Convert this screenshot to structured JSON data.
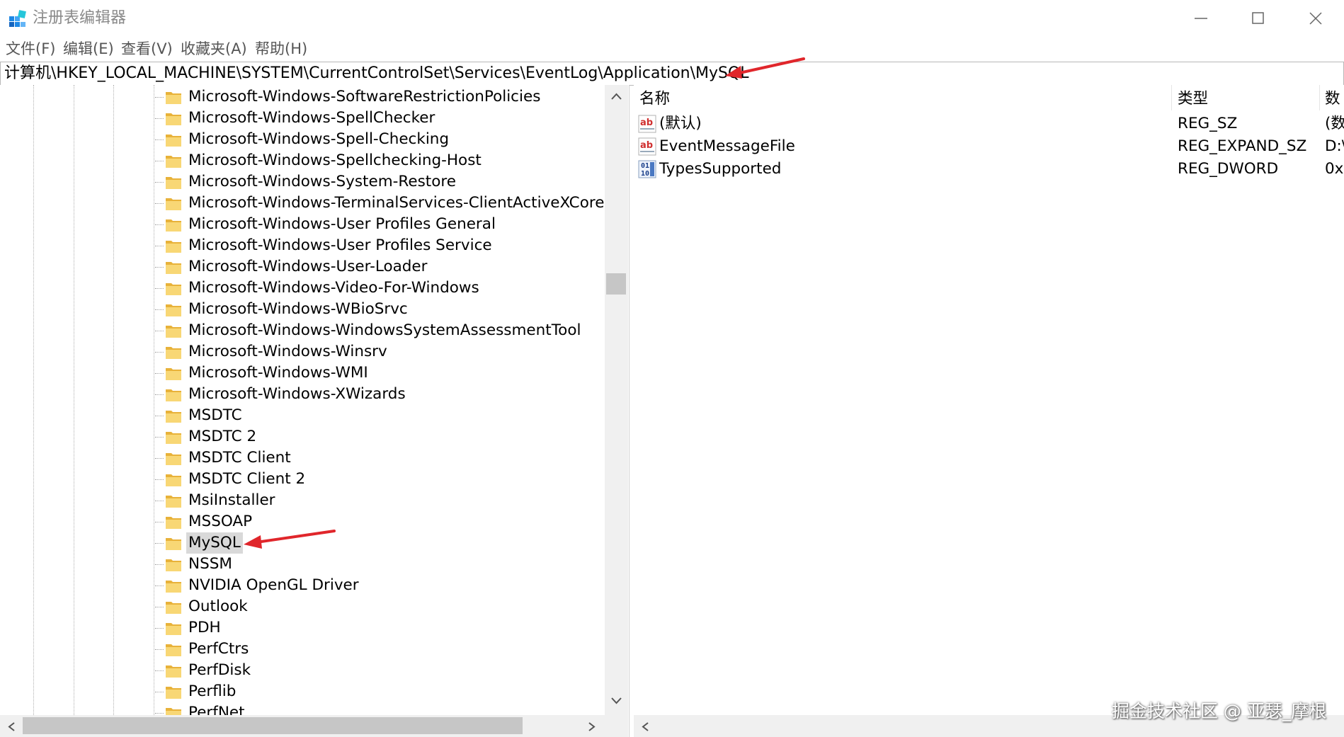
{
  "window": {
    "title": "注册表编辑器"
  },
  "menu": [
    "文件(F)",
    "编辑(E)",
    "查看(V)",
    "收藏夹(A)",
    "帮助(H)"
  ],
  "address": {
    "path": "计算机\\HKEY_LOCAL_MACHINE\\SYSTEM\\CurrentControlSet\\Services\\EventLog\\Application\\MySQL"
  },
  "tree": {
    "items": [
      "Microsoft-Windows-SoftwareRestrictionPolicies",
      "Microsoft-Windows-SpellChecker",
      "Microsoft-Windows-Spell-Checking",
      "Microsoft-Windows-Spellchecking-Host",
      "Microsoft-Windows-System-Restore",
      "Microsoft-Windows-TerminalServices-ClientActiveXCore",
      "Microsoft-Windows-User Profiles General",
      "Microsoft-Windows-User Profiles Service",
      "Microsoft-Windows-User-Loader",
      "Microsoft-Windows-Video-For-Windows",
      "Microsoft-Windows-WBioSrvc",
      "Microsoft-Windows-WindowsSystemAssessmentTool",
      "Microsoft-Windows-Winsrv",
      "Microsoft-Windows-WMI",
      "Microsoft-Windows-XWizards",
      "MSDTC",
      "MSDTC 2",
      "MSDTC Client",
      "MSDTC Client 2",
      "MsiInstaller",
      "MSSOAP",
      "MySQL",
      "NSSM",
      "NVIDIA OpenGL Driver",
      "Outlook",
      "PDH",
      "PerfCtrs",
      "PerfDisk",
      "Perflib",
      "PerfNet"
    ],
    "selected": "MySQL"
  },
  "values": {
    "columns": [
      "名称",
      "类型",
      "数"
    ],
    "rows": [
      {
        "name": "(默认)",
        "type": "REG_SZ",
        "data": "(数",
        "icon": "string-value-icon"
      },
      {
        "name": "EventMessageFile",
        "type": "REG_EXPAND_SZ",
        "data": "D:\\",
        "icon": "string-value-icon"
      },
      {
        "name": "TypesSupported",
        "type": "REG_DWORD",
        "data": "0x",
        "icon": "binary-value-icon"
      }
    ]
  },
  "watermark": "掘金技术社区 @ 亚瑟_摩根",
  "colors": {
    "annotation_arrow": "#e0262b",
    "folder": "#f2c55c",
    "selected_bg": "#d9d9d9"
  }
}
